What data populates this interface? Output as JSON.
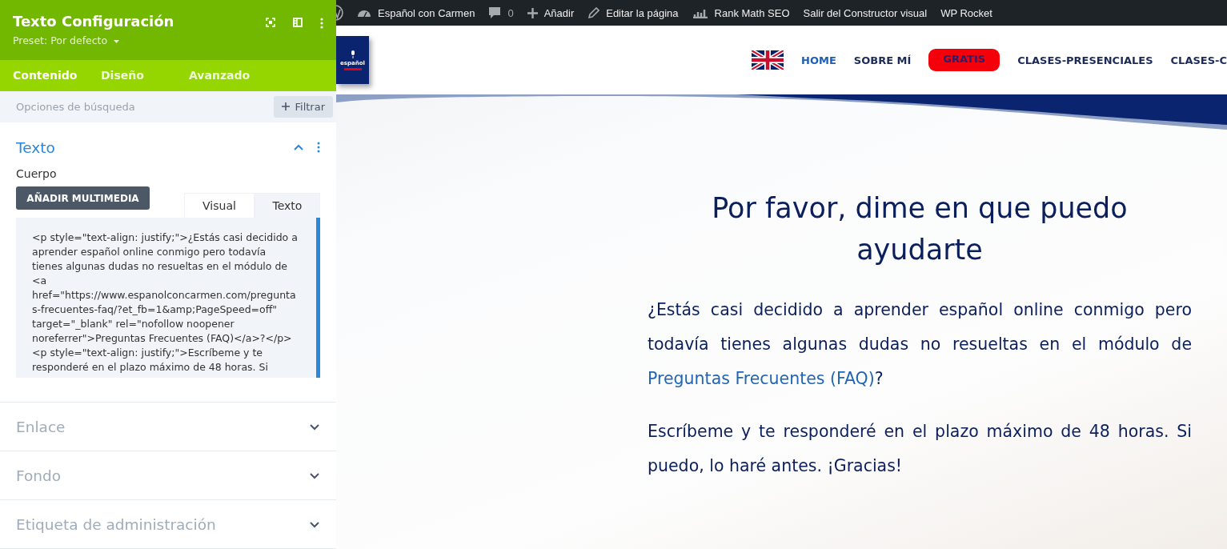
{
  "settings_panel": {
    "title": "Texto Configuración",
    "preset": "Preset: Por defecto",
    "tabs": [
      {
        "label": "Contenido",
        "selected": true
      },
      {
        "label": "Diseño",
        "selected": false
      },
      {
        "label": "Avanzado",
        "selected": false
      }
    ],
    "search": {
      "placeholder": "Opciones de búsqueda"
    },
    "filter_button": "Filtrar",
    "sections": [
      {
        "title": "Texto",
        "expanded": true,
        "field_label": "Cuerpo",
        "media_button": "AÑADIR MULTIMEDIA",
        "editor_tabs": [
          {
            "label": "Visual",
            "selected": false
          },
          {
            "label": "Texto",
            "selected": true
          }
        ],
        "code": "<p style=\"text-align: justify;\">¿Estás casi decidido a aprender español online conmigo pero todavía tienes algunas dudas no resueltas en el módulo de <a href=\"https://www.espanolconcarmen.com/preguntas-frecuentes-faq/?et_fb=1&amp;PageSpeed=off\" target=\"_blank\" rel=\"nofollow noopener noreferrer\">Preguntas Frecuentes (FAQ)</a>?</p>\n<p style=\"text-align: justify;\">Escríbeme y te responderé en el plazo máximo de 48 horas. Si"
      },
      {
        "title": "Enlace",
        "expanded": false
      },
      {
        "title": "Fondo",
        "expanded": false
      },
      {
        "title": "Etiqueta de administración",
        "expanded": false
      }
    ]
  },
  "admin_bar": {
    "items": [
      {
        "kind": "logo"
      },
      {
        "kind": "site",
        "label": "Español con Carmen"
      },
      {
        "kind": "comments",
        "label": "0"
      },
      {
        "kind": "add",
        "label": "Añadir"
      },
      {
        "kind": "edit",
        "label": "Editar la página"
      },
      {
        "kind": "seo",
        "label": "Rank Math SEO"
      },
      {
        "kind": "text",
        "label": "Salir del Constructor visual"
      },
      {
        "kind": "text",
        "label": "WP Rocket"
      }
    ]
  },
  "site": {
    "logo_text": "español",
    "nav": [
      {
        "kind": "flag"
      },
      {
        "kind": "link",
        "label": "HOME",
        "selected": true
      },
      {
        "kind": "link",
        "label": "SOBRE MÍ",
        "selected": false
      },
      {
        "kind": "pill",
        "label": "GRATIS"
      },
      {
        "kind": "link",
        "label": "CLASES-PRESENCIALES",
        "selected": false
      },
      {
        "kind": "link",
        "label": "CLASES-C",
        "selected": false
      }
    ],
    "heading": "Por favor, dime en que puedo ayudarte",
    "paragraphs": [
      {
        "before": "¿Estás casi decidido a aprender español online conmigo pero todavía tienes algunas dudas no resueltas en el módulo de ",
        "link": "Preguntas Frecuentes (FAQ)",
        "after": "?"
      },
      {
        "before": "Escríbeme y te responderé en el plazo máximo de 48 horas. Si puedo, lo haré antes. ¡Gracias!"
      }
    ]
  }
}
